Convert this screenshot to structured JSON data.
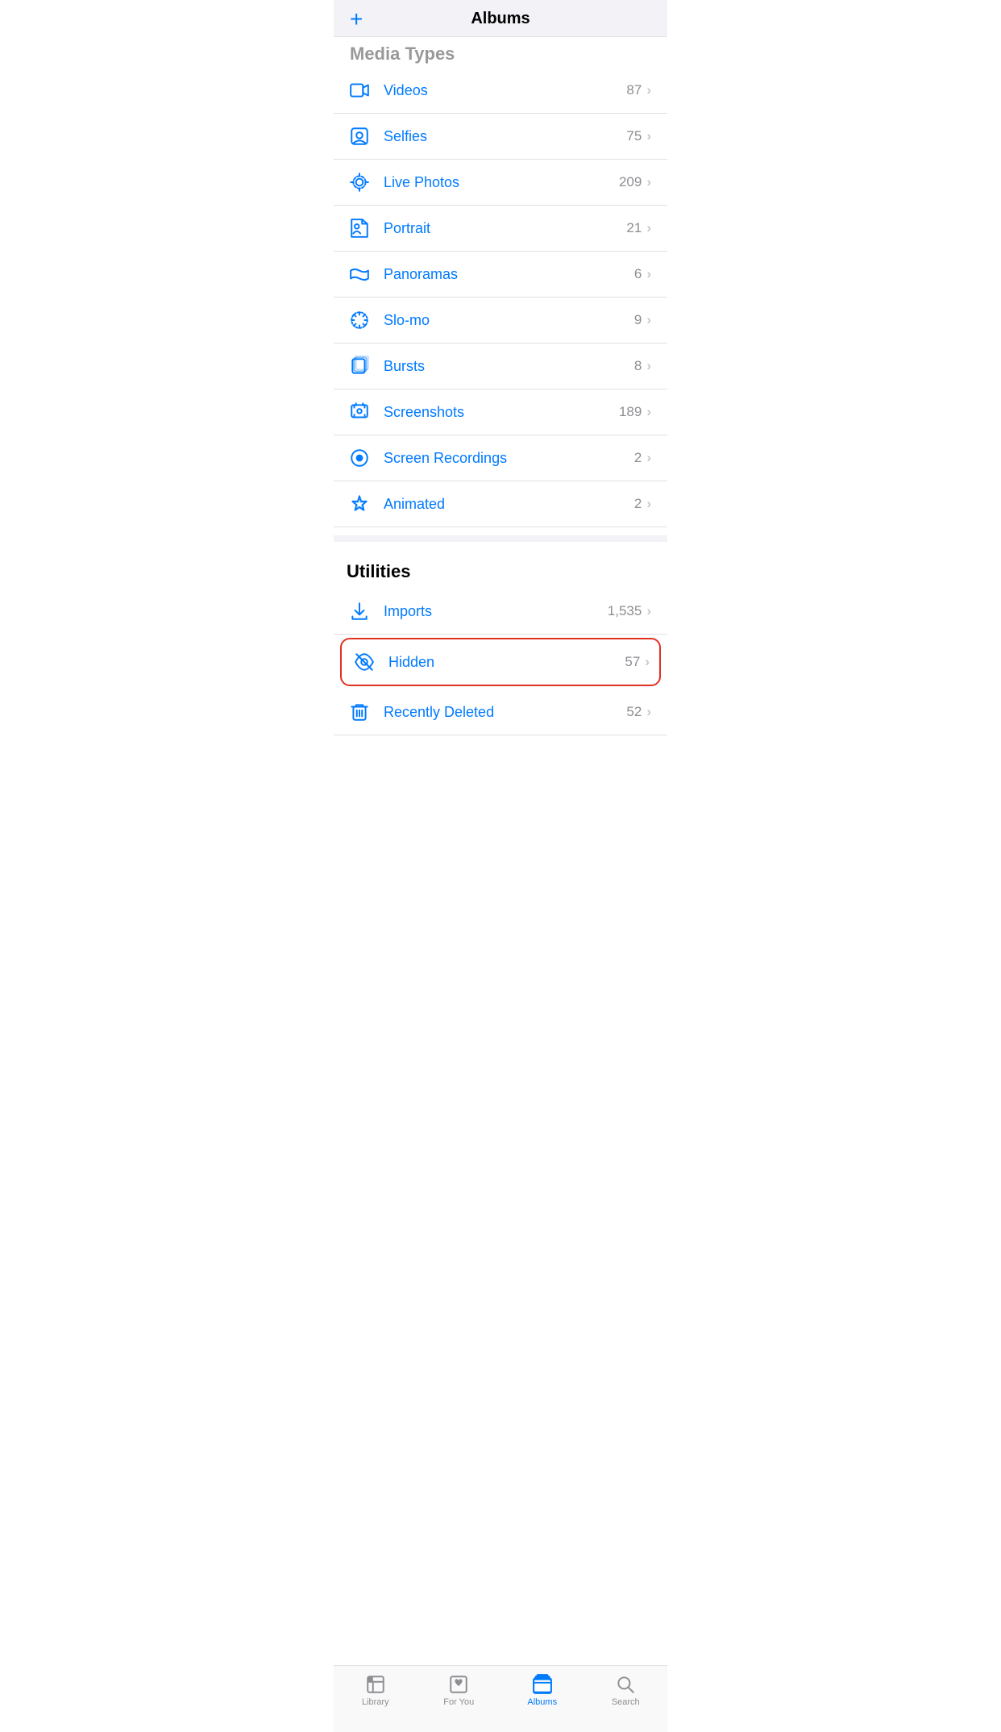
{
  "header": {
    "title": "Albums",
    "add_button_label": "+"
  },
  "media_types_section_label": "Media Types",
  "media_types": [
    {
      "id": "videos",
      "label": "Videos",
      "count": "87",
      "icon": "video"
    },
    {
      "id": "selfies",
      "label": "Selfies",
      "count": "75",
      "icon": "selfie"
    },
    {
      "id": "live-photos",
      "label": "Live Photos",
      "count": "209",
      "icon": "live-photo"
    },
    {
      "id": "portrait",
      "label": "Portrait",
      "count": "21",
      "icon": "portrait"
    },
    {
      "id": "panoramas",
      "label": "Panoramas",
      "count": "6",
      "icon": "panorama"
    },
    {
      "id": "slo-mo",
      "label": "Slo-mo",
      "count": "9",
      "icon": "slomo"
    },
    {
      "id": "bursts",
      "label": "Bursts",
      "count": "8",
      "icon": "bursts"
    },
    {
      "id": "screenshots",
      "label": "Screenshots",
      "count": "189",
      "icon": "screenshot"
    },
    {
      "id": "screen-recordings",
      "label": "Screen Recordings",
      "count": "2",
      "icon": "screen-recording"
    },
    {
      "id": "animated",
      "label": "Animated",
      "count": "2",
      "icon": "animated"
    }
  ],
  "utilities_section_label": "Utilities",
  "utilities": [
    {
      "id": "imports",
      "label": "Imports",
      "count": "1,535",
      "icon": "import",
      "highlighted": false
    },
    {
      "id": "hidden",
      "label": "Hidden",
      "count": "57",
      "icon": "hidden",
      "highlighted": true
    },
    {
      "id": "recently-deleted",
      "label": "Recently Deleted",
      "count": "52",
      "icon": "trash",
      "highlighted": false
    }
  ],
  "tab_bar": {
    "items": [
      {
        "id": "library",
        "label": "Library",
        "active": false
      },
      {
        "id": "for-you",
        "label": "For You",
        "active": false
      },
      {
        "id": "albums",
        "label": "Albums",
        "active": true
      },
      {
        "id": "search",
        "label": "Search",
        "active": false
      }
    ]
  }
}
